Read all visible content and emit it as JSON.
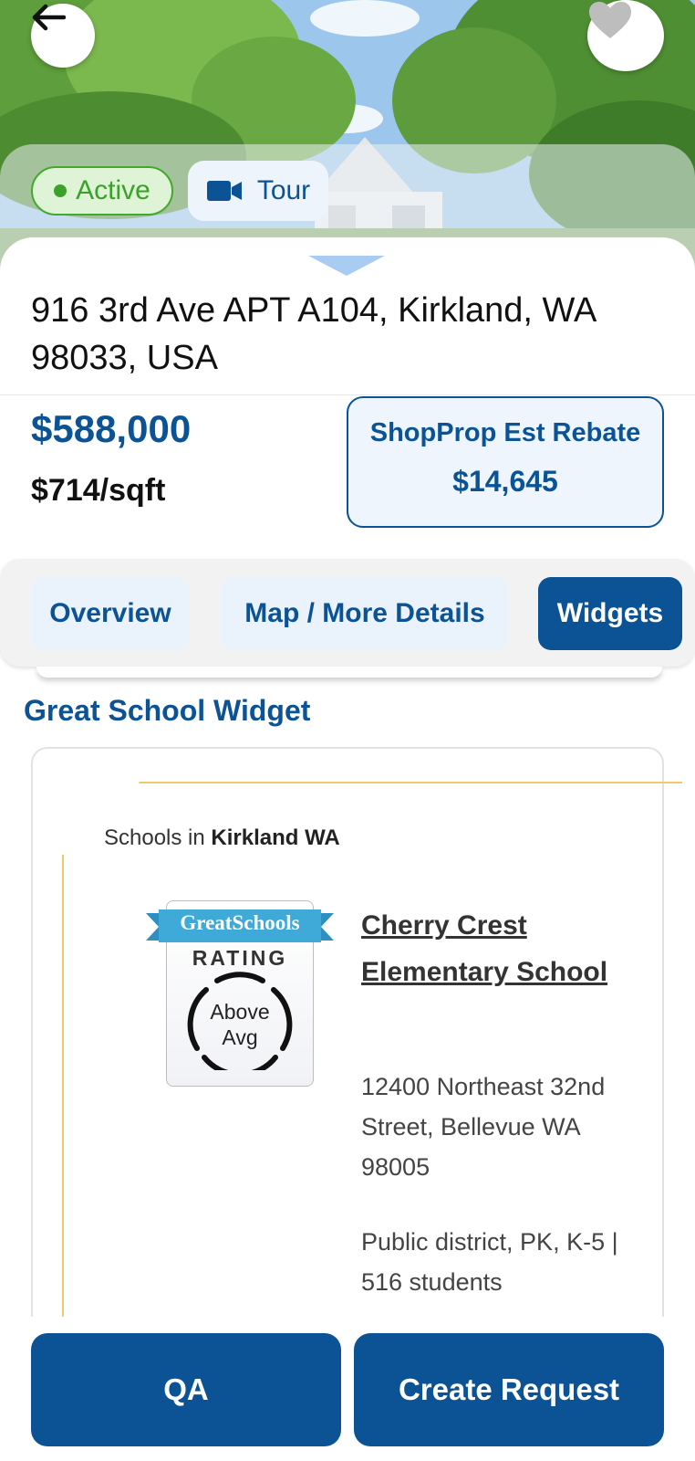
{
  "header": {
    "back_icon": "arrow-left-icon",
    "favorite_icon": "heart-icon"
  },
  "status": {
    "active_label": "Active",
    "active_color": "#3aa22a",
    "tour_label": "Tour",
    "tour_icon": "video-camera-icon"
  },
  "listing": {
    "address": "916 3rd Ave APT A104, Kirkland, WA 98033, USA",
    "price": "$588,000",
    "price_per_sqft": "$714/sqft",
    "rebate_label": "ShopProp Est Rebate",
    "rebate_value": "$14,645"
  },
  "tabs": [
    {
      "label": "Overview",
      "selected": false
    },
    {
      "label": "Map / More Details",
      "selected": false
    },
    {
      "label": "Widgets",
      "selected": true
    }
  ],
  "widget": {
    "section_title": "Great School Widget",
    "schools_in_prefix": "Schools in ",
    "schools_in_location": "Kirkland WA",
    "badge": {
      "brand": "GreatSchools",
      "rating_label": "RATING",
      "level_line1": "Above",
      "level_line2": "Avg"
    },
    "school": {
      "name": "Cherry Crest Elementary School",
      "address": "12400 Northeast 32nd Street, Bellevue WA 98005",
      "meta": "Public district, PK, K-5 | 516 students"
    }
  },
  "actions": {
    "qa_label": "QA",
    "create_label": "Create Request"
  },
  "colors": {
    "brand_blue": "#0b5394",
    "light_blue": "#eaf2fb",
    "accent_yellow": "#f2c86a",
    "greatschools_teal": "#3fa9d8"
  }
}
